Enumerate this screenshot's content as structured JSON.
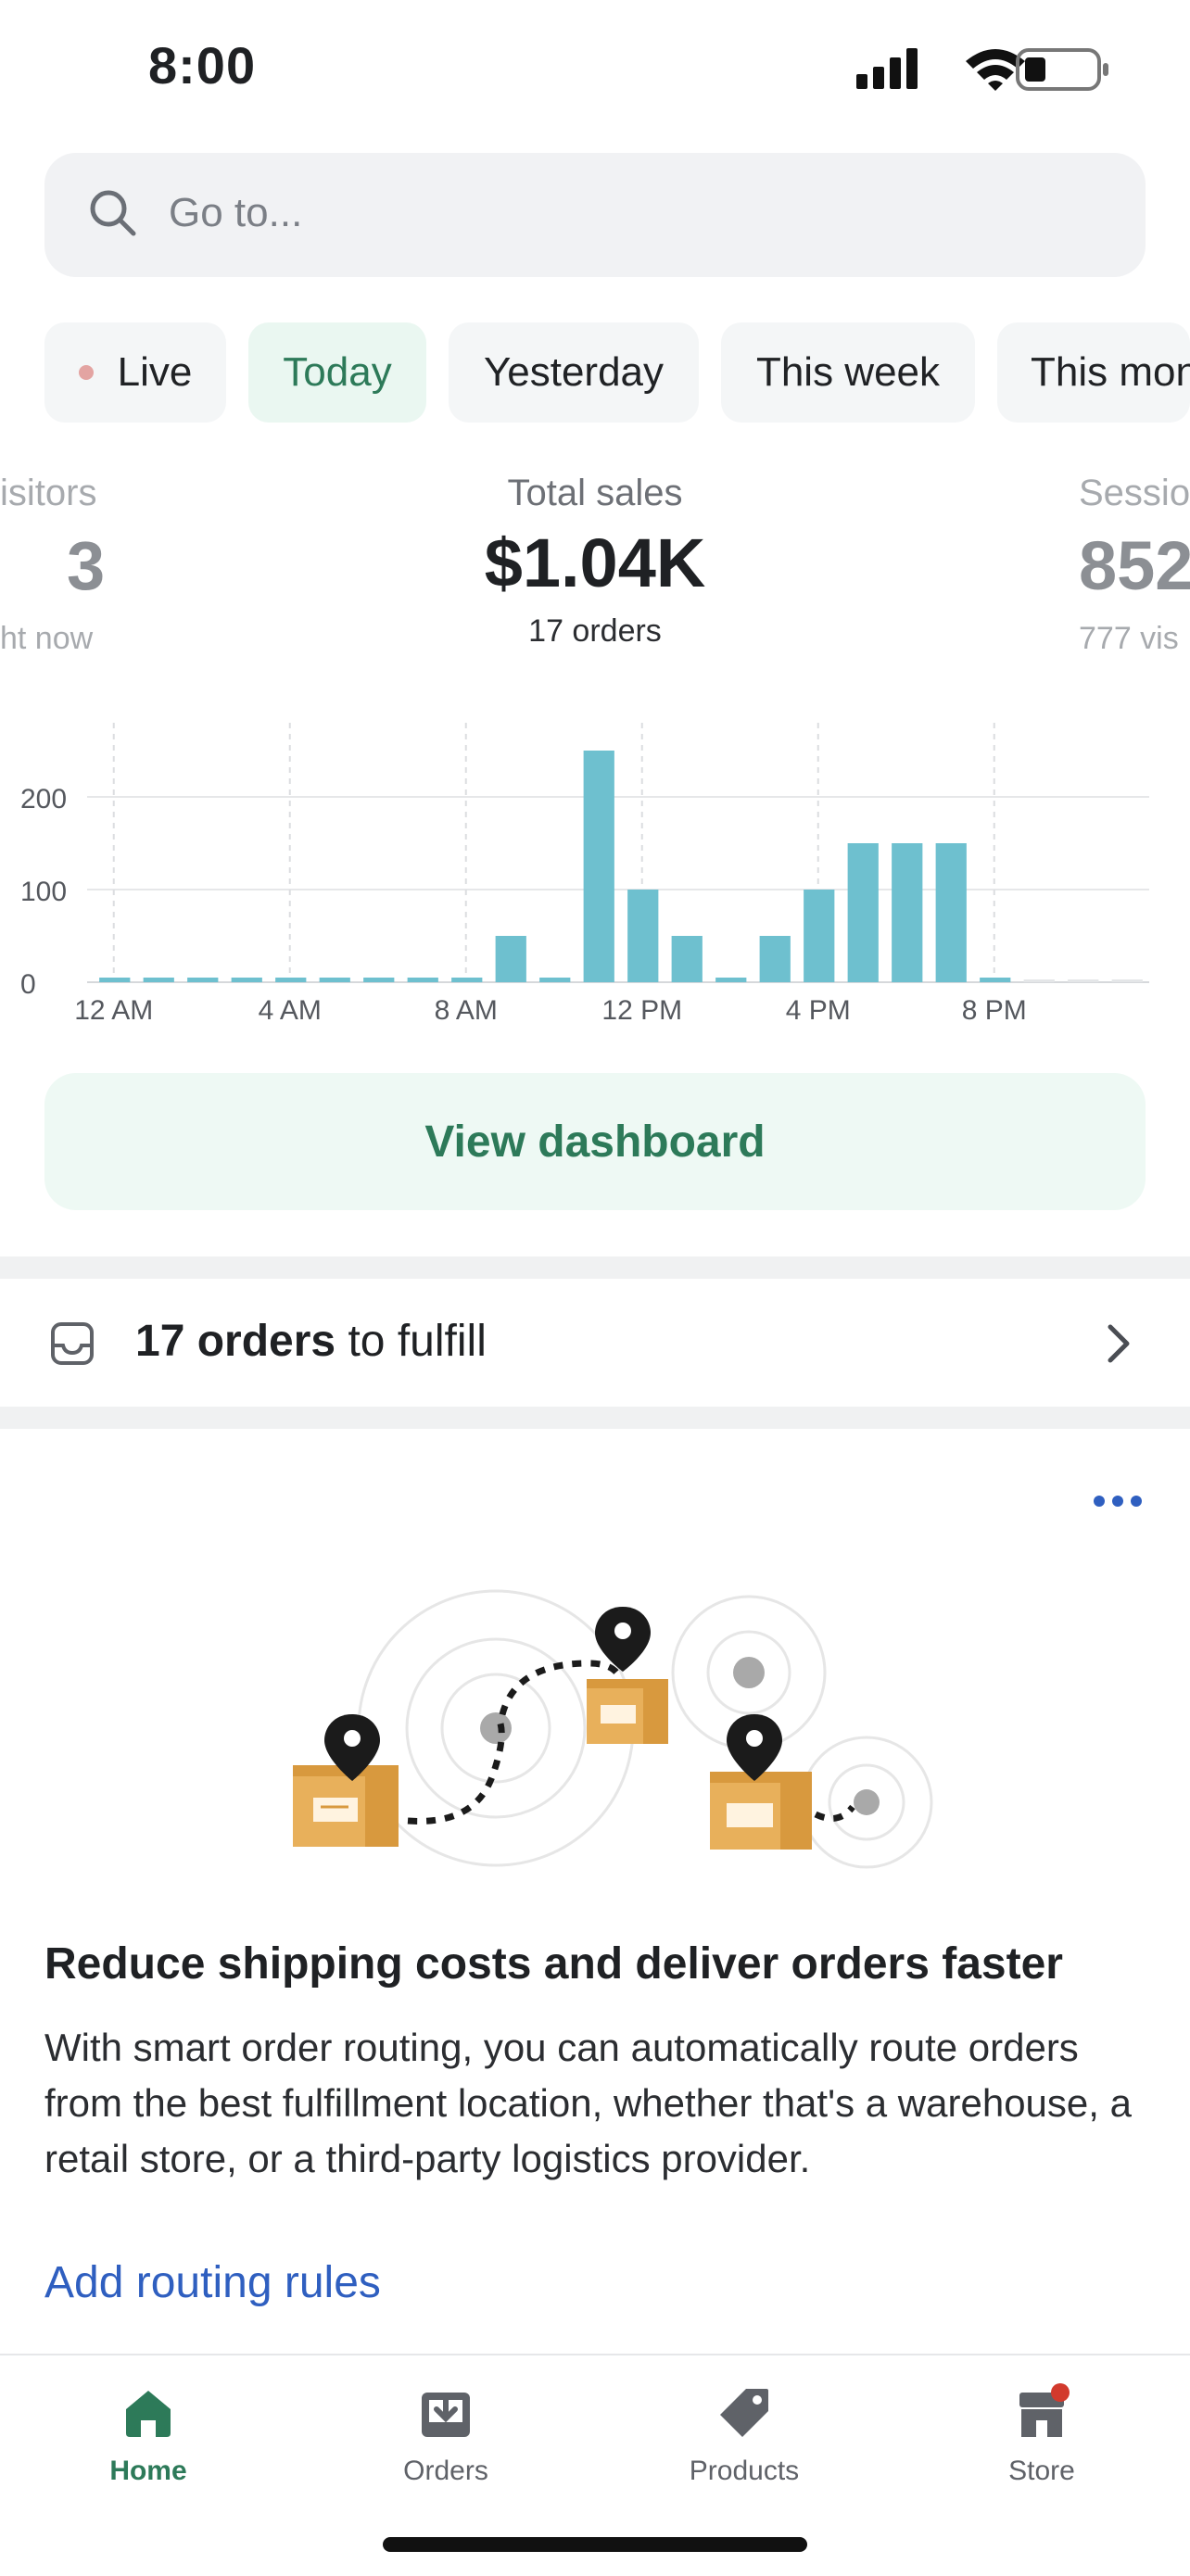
{
  "status_bar": {
    "time": "8:00"
  },
  "search": {
    "placeholder": "Go to..."
  },
  "filters": [
    {
      "label": "Live"
    },
    {
      "label": "Today"
    },
    {
      "label": "Yesterday"
    },
    {
      "label": "This week"
    },
    {
      "label": "This mon"
    }
  ],
  "metrics": {
    "left": {
      "label": "isitors",
      "value": "3",
      "sub": "ht now"
    },
    "center": {
      "label": "Total sales",
      "value": "$1.04K",
      "sub": "17 orders"
    },
    "right": {
      "label": "Sessio",
      "value": "852",
      "sub": "777 vis"
    }
  },
  "chart_data": {
    "type": "bar",
    "x": [
      "12 AM",
      "1 AM",
      "2 AM",
      "3 AM",
      "4 AM",
      "5 AM",
      "6 AM",
      "7 AM",
      "8 AM",
      "9 AM",
      "10 AM",
      "11 AM",
      "12 PM",
      "1 PM",
      "2 PM",
      "3 PM",
      "4 PM",
      "5 PM",
      "6 PM",
      "7 PM",
      "8 PM",
      "9 PM",
      "10 PM",
      "11 PM"
    ],
    "values": [
      5,
      5,
      5,
      5,
      5,
      5,
      5,
      5,
      5,
      50,
      5,
      250,
      100,
      50,
      5,
      50,
      100,
      150,
      150,
      150,
      5,
      3,
      3,
      3
    ],
    "future_from_index": 21,
    "x_tick_labels": [
      "12 AM",
      "4 AM",
      "8 AM",
      "12 PM",
      "4 PM",
      "8 PM"
    ],
    "y_ticks": [
      0,
      100,
      200
    ],
    "ylim": [
      0,
      280
    ],
    "grid": true,
    "bar_color": "#6ec0cf",
    "future_bar_color": "#e4e6e8"
  },
  "dashboard_button": {
    "label": "View dashboard"
  },
  "orders_row": {
    "count": "17 orders",
    "suffix": " to fulfill"
  },
  "card": {
    "title": "Reduce shipping costs and deliver orders faster",
    "body": "With smart order routing, you can automatically route orders from the best fulfillment location, whether that's a warehouse, a retail store, or a third-party logistics provider.",
    "link": "Add routing rules"
  },
  "tabs": [
    {
      "label": "Home",
      "icon": "home-icon",
      "active": true
    },
    {
      "label": "Orders",
      "icon": "orders-icon"
    },
    {
      "label": "Products",
      "icon": "tag-icon"
    },
    {
      "label": "Store",
      "icon": "store-icon"
    }
  ],
  "colors": {
    "accent_green": "#2d7a59",
    "chart_bar": "#6ec0cf",
    "link_blue": "#2f5fc0",
    "badge_red": "#d23a2d"
  }
}
